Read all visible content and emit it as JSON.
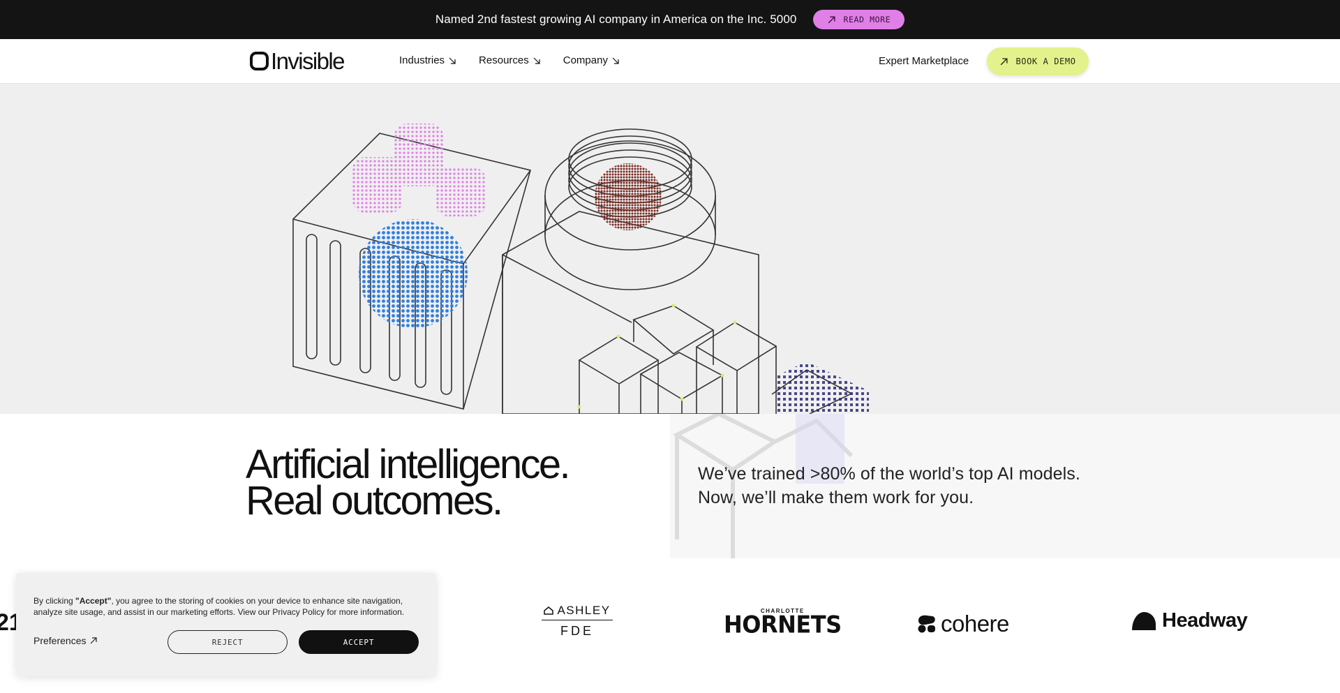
{
  "announcement": {
    "text": "Named 2nd fastest growing AI company in America on the Inc. 5000",
    "button_label": "READ MORE"
  },
  "nav": {
    "brand": "Invisible",
    "links": [
      {
        "label": "Industries"
      },
      {
        "label": "Resources"
      },
      {
        "label": "Company"
      }
    ],
    "expert_marketplace": "Expert Marketplace",
    "cta_label": "BOOK A DEMO"
  },
  "hero": {
    "headline_line1": "Artificial intelligence.",
    "headline_line2": "Real outcomes.",
    "subtext_line1": "We’ve trained >80% of the world’s top AI models.",
    "subtext_line2": "Now, we’ll make them work for you."
  },
  "logos": {
    "partial": "21",
    "ashley_top": "ASHLEY",
    "ashley_bottom": "FDE",
    "hornets_top": "CHARLOTTE",
    "hornets_main": "HORNETS",
    "cohere": "cohere",
    "headway": "Headway"
  },
  "cookie": {
    "text_prefix": "By clicking ",
    "text_bold": "\"Accept\"",
    "text_rest": ", you agree to the storing of cookies on your device to enhance site navigation, analyze site usage, and assist in our marketing efforts. View our Privacy Policy for more information.",
    "preferences_label": "Preferences",
    "reject_label": "REJECT",
    "accept_label": "ACCEPT"
  },
  "colors": {
    "announce_bg": "#141414",
    "read_more_bg": "#e07fe6",
    "book_demo_bg": "#e3f28c",
    "hero_bg": "#efefef",
    "accent_blue": "#2f7fe0",
    "accent_pink": "#e07fe6"
  },
  "icons": [
    "arrow-up-right-icon",
    "arrow-down-right-icon",
    "logo-mark-icon",
    "cohere-mark-icon",
    "headway-mark-icon"
  ]
}
